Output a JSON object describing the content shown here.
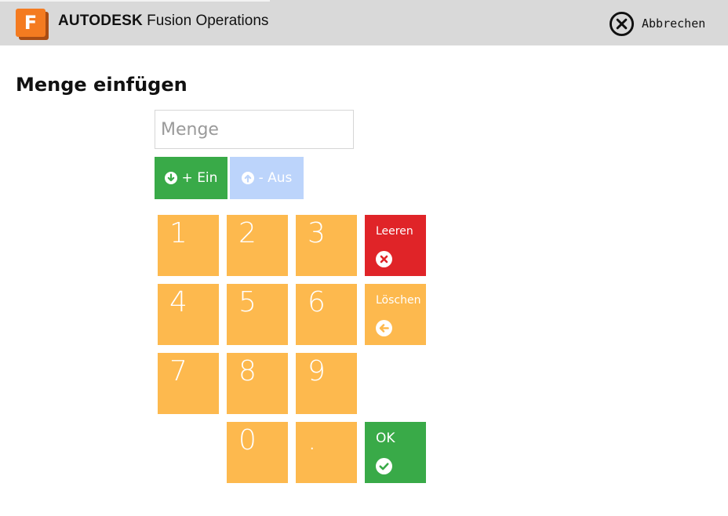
{
  "header": {
    "logo_letter": "F",
    "brand_bold": "AUTODESK",
    "brand_product": "Fusion Operations",
    "cancel_label": "Abbrechen"
  },
  "page": {
    "title": "Menge einfügen"
  },
  "quantity_input": {
    "placeholder": "Menge",
    "value": ""
  },
  "mode_buttons": {
    "in_label": "+ Ein",
    "out_label": "- Aus"
  },
  "keypad": {
    "keys": [
      "1",
      "2",
      "3",
      "4",
      "5",
      "6",
      "7",
      "8",
      "9",
      "0",
      "."
    ],
    "clear_label": "Leeren",
    "delete_label": "Löschen",
    "ok_label": "OK"
  },
  "colors": {
    "header_bg": "#d9d9d9",
    "logo_orange": "#f47b20",
    "key_orange": "#fdb94e",
    "clear_red": "#e02428",
    "green": "#39aa48",
    "out_disabled_blue": "#bcd4fb"
  },
  "icons": {
    "cancel": "close-circle-icon",
    "in": "arrow-down-circle-icon",
    "out": "arrow-up-circle-icon",
    "clear": "x-circle-icon",
    "delete": "arrow-left-circle-icon",
    "ok": "check-circle-icon"
  }
}
